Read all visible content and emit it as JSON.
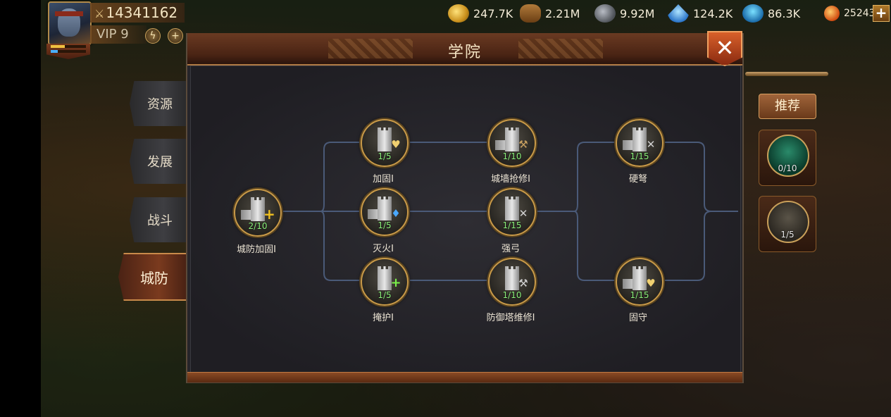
{
  "player": {
    "power": "14341162",
    "vip": "VIP 9"
  },
  "resources": [
    {
      "name": "gold",
      "icon": "gold-coins-icon",
      "value": "247.7K"
    },
    {
      "name": "wood",
      "icon": "wood-logs-icon",
      "value": "2.21M"
    },
    {
      "name": "stone",
      "icon": "ore-icon",
      "value": "9.92M"
    },
    {
      "name": "crystal",
      "icon": "crystal-icon",
      "value": "124.2K"
    },
    {
      "name": "mana",
      "icon": "mana-icon",
      "value": "86.3K"
    },
    {
      "name": "gems",
      "icon": "gem-icon",
      "value": "25243"
    }
  ],
  "categories": [
    {
      "label": "资源",
      "active": false
    },
    {
      "label": "发展",
      "active": false
    },
    {
      "label": "战斗",
      "active": false
    },
    {
      "label": "城防",
      "active": true
    }
  ],
  "modal": {
    "title": "学院",
    "close_symbol": "✕"
  },
  "tree": {
    "nodes": [
      {
        "id": "city-defense-reinforce",
        "label": "城防加固I",
        "level": "2/10"
      },
      {
        "id": "reinforce",
        "label": "加固I",
        "level": "1/5"
      },
      {
        "id": "extinguish",
        "label": "灭火I",
        "level": "1/5"
      },
      {
        "id": "shelter",
        "label": "掩护I",
        "level": "1/5"
      },
      {
        "id": "wall-repair",
        "label": "城墙抢修I",
        "level": "1/10"
      },
      {
        "id": "strong-bow",
        "label": "强弓",
        "level": "1/15"
      },
      {
        "id": "tower-repair",
        "label": "防御塔维修I",
        "level": "1/10"
      },
      {
        "id": "hard-crossbow",
        "label": "硬弩",
        "level": "1/15"
      },
      {
        "id": "hold-firm",
        "label": "固守",
        "level": "1/15"
      }
    ]
  },
  "side_panel": {
    "recommend_label": "推荐",
    "slots": [
      {
        "icon": "green-boost-icon",
        "count": "0/10"
      },
      {
        "icon": "tower-heart-icon",
        "count": "1/5"
      }
    ]
  },
  "colors": {
    "accent_gold": "#c99a48",
    "level_green": "#8af07a",
    "active_tab": "#7a3a1e"
  }
}
